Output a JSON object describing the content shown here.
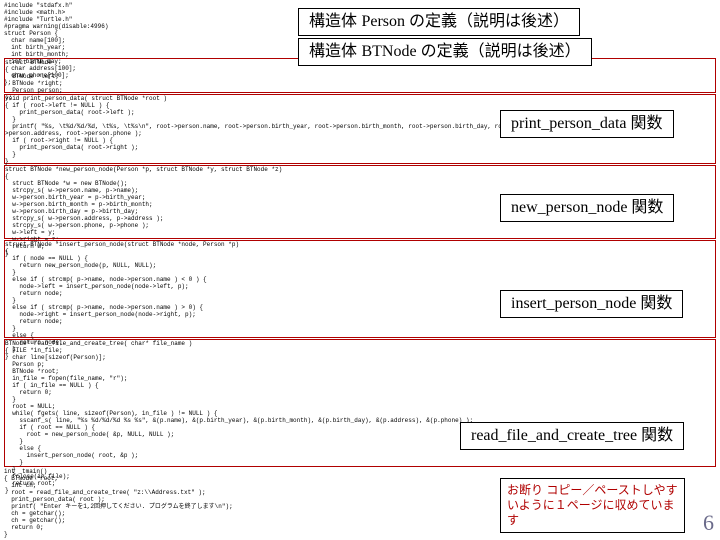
{
  "code": {
    "includes": "#include \"stdafx.h\"\n#include <math.h>\n#include \"Turtle.h\"\n#pragma warning(disable:4996)\nstruct Person {\n  char name[100];\n  int birth_year;\n  int birth_month;\n  int birth_day;\n  char address[100];\n  char phone[100];\n};",
    "btnode": "struct BTNode\n{\n  BTNode *left;\n  BTNode *right;\n  Person person;\n};",
    "print_person": "void print_person_data( struct BTNode *root )\n{ if ( root->left != NULL ) {\n    print_person_data( root->left );\n  }\n  printf( \"%s, \\t%d/%d/%d, \\t%s, \\t%s\\n\", root->person.name, root->person.birth_year, root->person.birth_month, root->person.birth_day, root-\n>person.address, root->person.phone );\n  if ( root->right != NULL ) {\n    print_person_data( root->right );\n  }\n}",
    "new_person": "struct BTNode *new_person_node(Person *p, struct BTNode *y, struct BTNode *z)\n{\n  struct BTNode *w = new BTNode();\n  strcpy_s( w->person.name, p->name);\n  w->person.birth_year = p->birth_year;\n  w->person.birth_month = p->birth_month;\n  w->person.birth_day = p->birth_day;\n  strcpy_s( w->person.address, p->address );\n  strcpy_s( w->person.phone, p->phone );\n  w->left = y;\n  w->right = z;\n  return w;\n}",
    "insert_person": "struct BTNode *insert_person_node(struct BTNode *node, Person *p)\n{\n  if ( node == NULL ) {\n    return new_person_node(p, NULL, NULL);\n  }\n  else if ( strcmp( p->name, node->person.name ) < 0 ) {\n    node->left = insert_person_node(node->left, p);\n    return node;\n  }\n  else if ( strcmp( p->name, node->person.name ) > 0) {\n    node->right = insert_person_node(node->right, p);\n    return node;\n  }\n  else {\n    return node;\n  }\n}",
    "read_file": "BTNode* read_file_and_create_tree( char* file_name )\n{ FILE *in_file;\n  char line[sizeof(Person)];\n  Person p;\n  BTNode *root;\n  in_file = fopen(file_name, \"r\");\n  if ( in_file == NULL ) {\n    return 0;\n  }\n  root = NULL;\n  while( fgets( line, sizeof(Person), in_file ) != NULL ) {\n    sscanf_s( line, \"%s %d/%d/%d %s %s\", &(p.name), &(p.birth_year), &(p.birth_month), &(p.birth_day), &(p.address), &(p.phone) );\n    if ( root == NULL ) {\n      root = new_person_node( &p, NULL, NULL );\n    }\n    else {\n      insert_person_node( root, &p );\n    }\n  }\n  fclose(in_file);\n  return root;\n}",
    "main": "int _tmain()\n{ BTNode *root;\n  int ch;\n  root = read_file_and_create_tree( \"z:\\\\Address.txt\" );\n  print_person_data( root );\n  printf( \"Enter キーを1,2回押してください. プログラムを終了します\\n\");\n  ch = getchar();\n  ch = getchar();\n  return 0;\n}"
  },
  "callouts": {
    "c1_pre": "構造体 ",
    "c1_eng": "Person ",
    "c1_post": "の定義（説明は後述）",
    "c2_pre": "構造体 ",
    "c2_eng": "BTNode ",
    "c2_post": "の定義（説明は後述）",
    "c3_eng": "print_person_data ",
    "c3_post": "関数",
    "c4_eng": "new_person_node ",
    "c4_post": "関数",
    "c5_eng": "insert_person_node ",
    "c5_post": "関数",
    "c6_eng": "read_file_and_create_tree ",
    "c6_post": "関数"
  },
  "note": "お断り\nコピー／ペーストしやすいように１ページに収めています",
  "pagenum": "6"
}
